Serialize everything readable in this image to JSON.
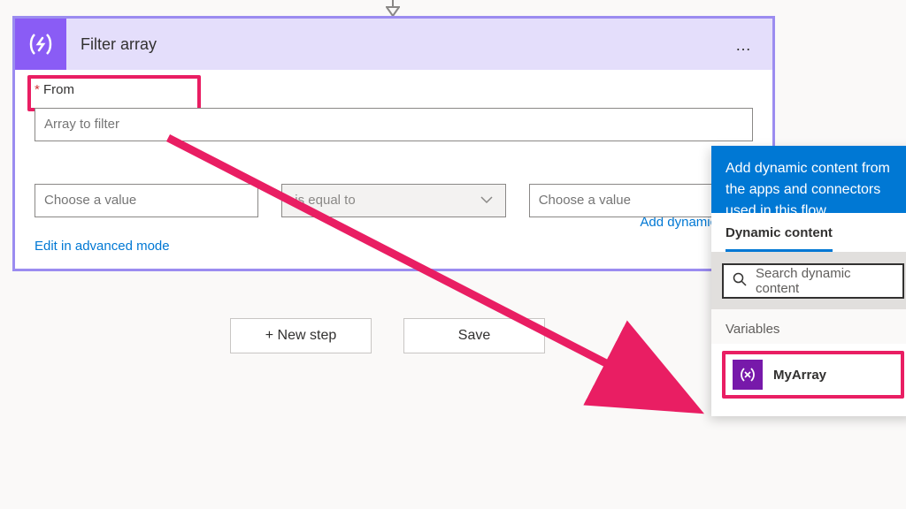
{
  "connector": {
    "icon": "arrow-down"
  },
  "card": {
    "title": "Filter array",
    "menu_label": "…",
    "from": {
      "label": "From",
      "required": "*",
      "placeholder": "Array to filter"
    },
    "add_dynamic_link": "Add dynamic conte",
    "condition": {
      "left_placeholder": "Choose a value",
      "operator": "is equal to",
      "right_placeholder": "Choose a value"
    },
    "advanced_mode": "Edit in advanced mode"
  },
  "buttons": {
    "new_step": "+ New step",
    "save": "Save"
  },
  "dynamic_panel": {
    "banner": "Add dynamic content from the apps and connectors used in this flow.",
    "tab_dynamic": "Dynamic content",
    "search_placeholder": "Search dynamic content",
    "section_variables": "Variables",
    "variable_item": "MyArray"
  },
  "colors": {
    "highlight": "#e91e63",
    "azure_blue": "#0078d4",
    "purple_icon": "#8a5cf5",
    "card_border": "#9b8cf0",
    "var_purple": "#7719aa"
  }
}
